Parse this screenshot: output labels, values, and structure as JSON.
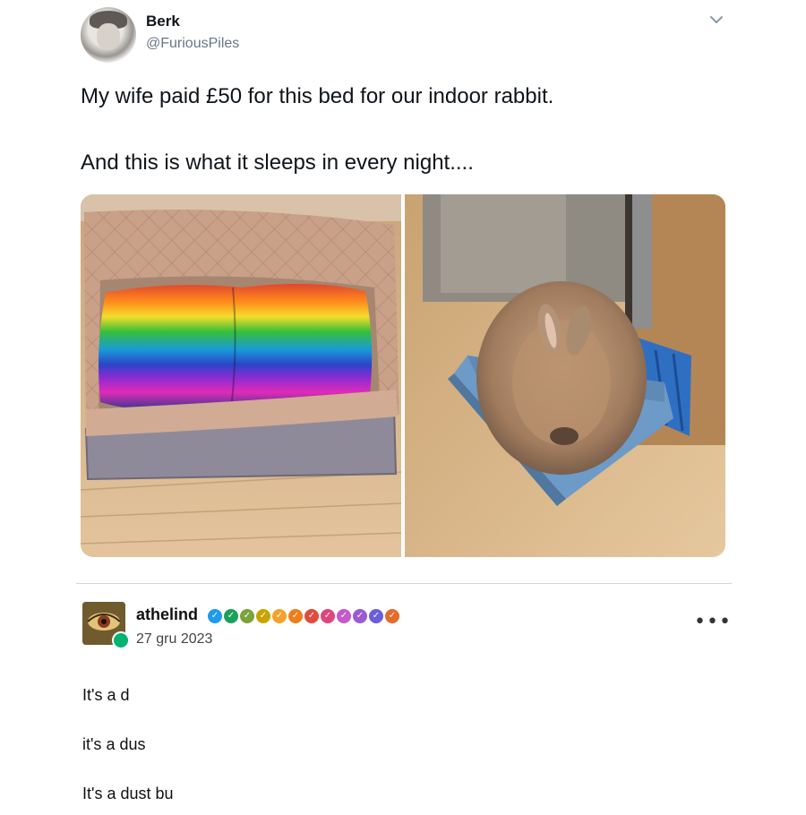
{
  "tweet": {
    "display_name": "Berk",
    "handle": "@FuriousPiles",
    "text_lines": [
      "My wife paid £50 for this bed for our indoor rabbit.",
      "And this is what it sleeps in every night...."
    ],
    "menu_icon": "chevron-down-icon"
  },
  "reply": {
    "username": "athelind",
    "date": "27 gru 2023",
    "badge_colors": [
      "#1d9bf0",
      "#1aa15a",
      "#7aa33a",
      "#c9a400",
      "#f2a22a",
      "#ef7d1a",
      "#e24b3b",
      "#e0457b",
      "#c65ac6",
      "#9b59d6",
      "#6a5de0",
      "#e86a2a"
    ],
    "menu_icon": "more-icon",
    "menu_glyph": "•••",
    "lines": [
      "It's a d",
      "it's a dus",
      "It's a dust bu"
    ]
  }
}
